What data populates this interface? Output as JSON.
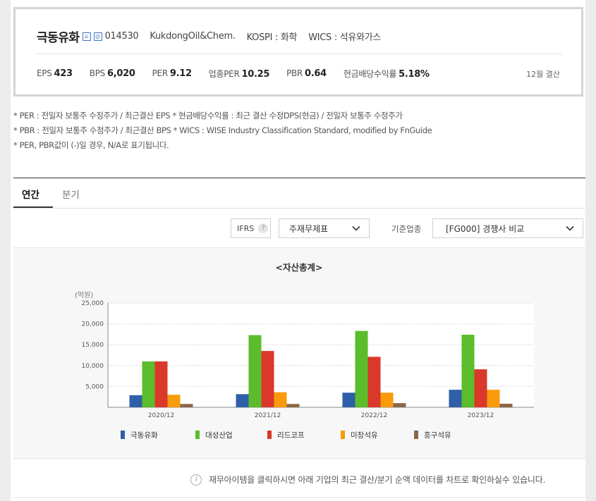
{
  "header": {
    "company": "극동유화",
    "icons": [
      "kospi-badge-icon",
      "kospi200-badge-icon"
    ],
    "code": "014530",
    "english_name": "KukdongOil&Chem.",
    "market": "KOSPI : 화학",
    "wics": "WICS : 석유와가스",
    "ratios": [
      {
        "label": "EPS",
        "value": "423"
      },
      {
        "label": "BPS",
        "value": "6,020"
      },
      {
        "label": "PER",
        "value": "9.12"
      },
      {
        "label": "업종PER",
        "value": "10.25"
      },
      {
        "label": "PBR",
        "value": "0.64"
      },
      {
        "label": "현금배당수익률",
        "value": "5.18%"
      }
    ],
    "settlement": "12월 결산"
  },
  "notes": [
    "* PER : 전일자 보통주 수정주가 / 최근결산 EPS * 현금배당수익률 : 최근 결산 수정DPS(현금) / 전일자 보통주 수정주가",
    "* PBR : 전일자 보통주 수정주가 / 최근결산 BPS * WICS : WISE Industry Classification Standard, modified by FnGuide",
    "* PER, PBR값이 (-)일 경우, N/A로 표기됩니다."
  ],
  "tabs": [
    {
      "label": "연간",
      "active": true
    },
    {
      "label": "분기",
      "active": false
    }
  ],
  "controls": {
    "ifrs_label": "IFRS",
    "help_symbol": "?",
    "statement_select": "주재무제표",
    "industry_label": "기준업종",
    "industry_select": "[FG000] 경쟁사 비교"
  },
  "chart_data": {
    "type": "bar",
    "title": "<자산총계>",
    "ylabel": "(억원)",
    "ylim": [
      0,
      25000
    ],
    "yticks": [
      "5,000",
      "10,000",
      "15,000",
      "20,000",
      "25,000"
    ],
    "categories": [
      "2020/12",
      "2021/12",
      "2022/12",
      "2023/12"
    ],
    "legend_position": "bottom",
    "series": [
      {
        "name": "극동유화",
        "color": "#2f5fa7",
        "values": [
          2900,
          3150,
          3500,
          4200
        ]
      },
      {
        "name": "대성산업",
        "color": "#5bbd2b",
        "values": [
          11000,
          17300,
          18300,
          17400
        ]
      },
      {
        "name": "리드코프",
        "color": "#d9382a",
        "values": [
          11000,
          13500,
          12100,
          9100
        ]
      },
      {
        "name": "미창석유",
        "color": "#f99b0c",
        "values": [
          3000,
          3600,
          3500,
          4200
        ]
      },
      {
        "name": "흥구석유",
        "color": "#8b6748",
        "values": [
          800,
          800,
          1000,
          850
        ]
      }
    ]
  },
  "footer": {
    "info_symbol": "i",
    "note": "재무아이템을 클릭하시면 아래 기업의 최근 결산/분기 순액 데이터를 차트로 확인하실수 있습니다."
  }
}
